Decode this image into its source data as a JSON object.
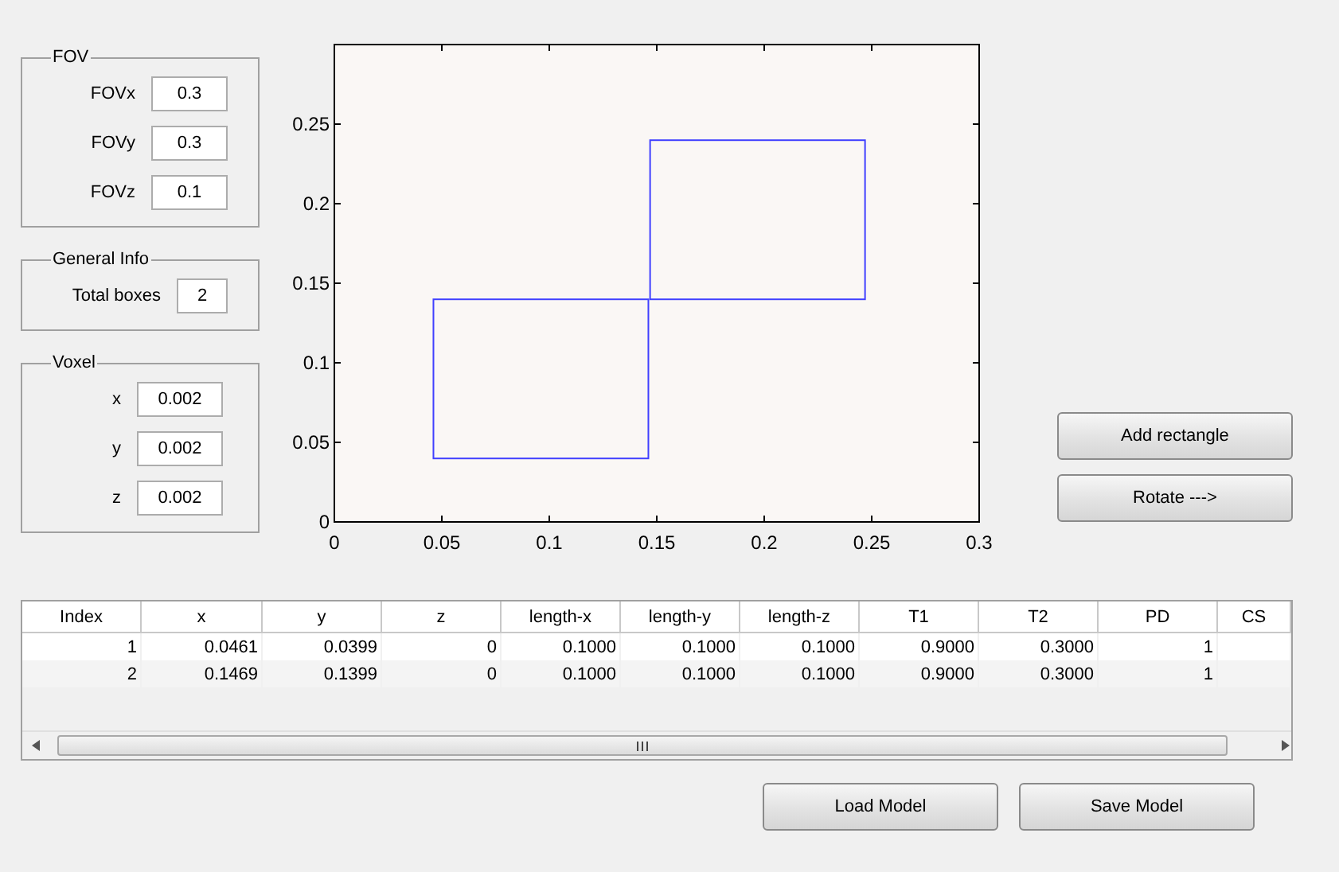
{
  "panels": [
    {
      "title": "FOV",
      "fields": [
        {
          "label": "FOVx",
          "value": "0.3"
        },
        {
          "label": "FOVy",
          "value": "0.3"
        },
        {
          "label": "FOVz",
          "value": "0.1"
        }
      ]
    },
    {
      "title": "General Info",
      "fields": [
        {
          "label": "Total boxes",
          "value": "2"
        }
      ]
    },
    {
      "title": "Voxel",
      "fields": [
        {
          "label": "x",
          "value": "0.002"
        },
        {
          "label": "y",
          "value": "0.002"
        },
        {
          "label": "z",
          "value": "0.002"
        }
      ]
    }
  ],
  "plot": {
    "chart_data": {
      "type": "line",
      "xlim": [
        0,
        0.3
      ],
      "ylim": [
        0,
        0.3
      ],
      "xticks": [
        {
          "value": 0,
          "label": "0"
        },
        {
          "value": 0.05,
          "label": "0.05"
        },
        {
          "value": 0.1,
          "label": "0.1"
        },
        {
          "value": 0.15,
          "label": "0.15"
        },
        {
          "value": 0.2,
          "label": "0.2"
        },
        {
          "value": 0.25,
          "label": "0.25"
        },
        {
          "value": 0.3,
          "label": "0.3"
        }
      ],
      "yticks": [
        {
          "value": 0,
          "label": "0"
        },
        {
          "value": 0.05,
          "label": "0.05"
        },
        {
          "value": 0.1,
          "label": "0.1"
        },
        {
          "value": 0.15,
          "label": "0.15"
        },
        {
          "value": 0.2,
          "label": "0.2"
        },
        {
          "value": 0.25,
          "label": "0.25"
        }
      ]
    }
  },
  "side_buttons": [
    "Add rectangle",
    "Rotate --->"
  ],
  "table": {
    "columns": [
      "Index",
      "x",
      "y",
      "z",
      "length-x",
      "length-y",
      "length-z",
      "T1",
      "T2",
      "PD",
      "CS"
    ],
    "rows": [
      [
        "1",
        "0.0461",
        "0.0399",
        "0",
        "0.1000",
        "0.1000",
        "0.1000",
        "0.9000",
        "0.3000",
        "1",
        ""
      ],
      [
        "2",
        "0.1469",
        "0.1399",
        "0",
        "0.1000",
        "0.1000",
        "0.1000",
        "0.9000",
        "0.3000",
        "1",
        ""
      ]
    ]
  },
  "bottom_buttons": [
    "Load Model",
    "Save Model"
  ]
}
